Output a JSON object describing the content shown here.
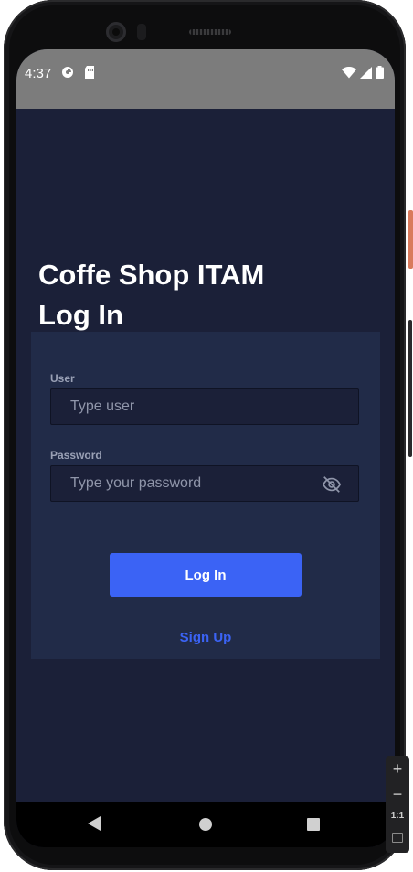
{
  "status_bar": {
    "time": "4:37"
  },
  "app": {
    "title_line1": "Coffe Shop ITAM",
    "title_line2": "Log In"
  },
  "form": {
    "user_label": "User",
    "user_placeholder": "Type user",
    "password_label": "Password",
    "password_placeholder": "Type your password",
    "login_button": "Log In",
    "signup_link": "Sign Up"
  },
  "emulator_controls": {
    "zoom_in": "+",
    "zoom_out": "−",
    "ratio": "1:1"
  },
  "colors": {
    "background": "#1b2038",
    "card": "#212b48",
    "accent": "#3b63f5",
    "status_bar": "#7c7c7c"
  },
  "icons": {
    "password_toggle": "eye-off-icon",
    "wifi": "wifi-icon",
    "signal": "signal-icon",
    "battery": "battery-icon"
  }
}
